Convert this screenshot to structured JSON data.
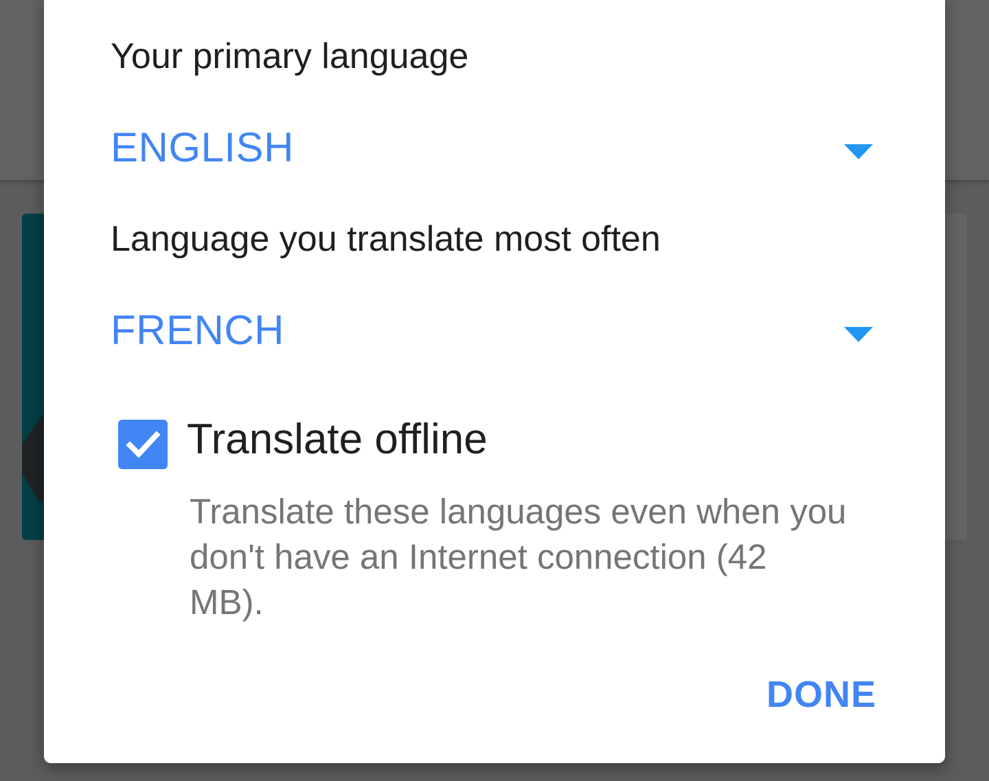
{
  "dialog": {
    "primary_language_label": "Your primary language",
    "primary_language_value": "ENGLISH",
    "translate_language_label": "Language you translate most often",
    "translate_language_value": "FRENCH",
    "offline": {
      "checked": true,
      "title": "Translate offline",
      "description": "Translate these languages even when you don't have an Internet connection (42 MB)."
    },
    "done_label": "DONE"
  },
  "colors": {
    "accent": "#4285f4",
    "caret": "#2196f3",
    "scrim": "#5c5c5c",
    "text_primary": "#1f1f1f",
    "text_secondary": "#757575"
  },
  "icons": {
    "spinner_caret": "triangle-down-icon",
    "checkbox": "checkmark-icon"
  }
}
